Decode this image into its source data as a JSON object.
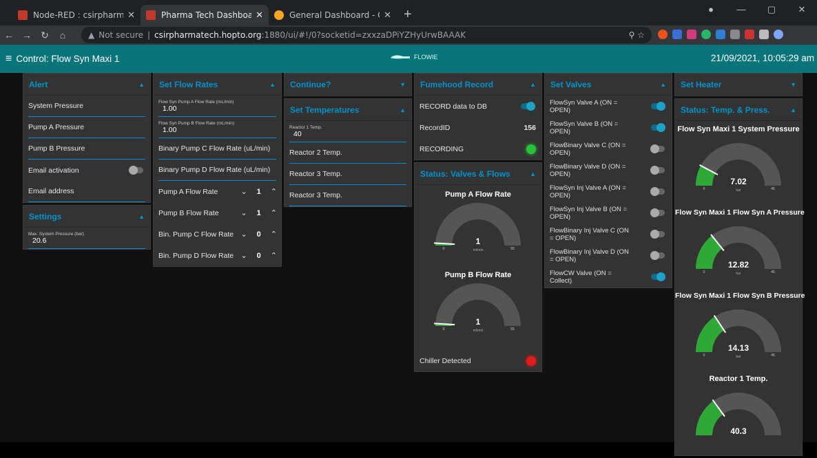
{
  "browser": {
    "tabs": [
      {
        "title": "Node-RED : csirpharmatech.hopt",
        "color": "#e53935"
      },
      {
        "title": "Pharma Tech Dashboard",
        "color": "#e53935"
      },
      {
        "title": "General Dashboard - Grafana",
        "color": "#f5a623"
      }
    ],
    "not_secure": "Not secure",
    "host": "csirpharmatech.hopto.org",
    "path": ":1880/ui/#!/0?socketid=zxxzaDPiYZHyUrwBAAAK"
  },
  "dashboard": {
    "title": "Control: Flow Syn Maxi 1",
    "logo": "FLOWIE",
    "clock": "21/09/2021, 10:05:29 am"
  },
  "alert": {
    "title": "Alert",
    "fields": [
      "System Pressure",
      "Pump A Pressure",
      "Pump B Pressure"
    ],
    "email_activation": "Email activation",
    "email_address": "Email address"
  },
  "settings": {
    "title": "Settings",
    "max_label": "Max. System Pressure (bar)",
    "max_value": "20.6"
  },
  "flow_rates": {
    "title": "Set Flow Rates",
    "pump_a_label": "Flow Syn Pump A Flow Rate (mL/min)",
    "pump_a_value": "1.00",
    "pump_b_label": "Flow Syn Pump B Flow Rate (mL/min)",
    "pump_b_value": "1.00",
    "bin_c": "Binary Pump C Flow Rate (uL/min)",
    "bin_d": "Binary Pump D Flow Rate (uL/min)",
    "steppers": [
      {
        "label": "Pump A Flow Rate",
        "value": "1"
      },
      {
        "label": "Pump B Flow Rate",
        "value": "1"
      },
      {
        "label": "Bin. Pump C Flow Rate",
        "value": "0"
      },
      {
        "label": "Bin. Pump D Flow Rate",
        "value": "0"
      }
    ]
  },
  "continue": {
    "title": "Continue?"
  },
  "temperatures": {
    "title": "Set Temperatures",
    "r1_label": "Reactor 1 Temp.",
    "r1_value": "40",
    "r2": "Reactor 2 Temp.",
    "r3a": "Reactor 3 Temp.",
    "r3b": "Reactor 3 Temp."
  },
  "fumehood": {
    "title": "Fumehood Record",
    "record": "RECORD data to DB",
    "record_id_label": "RecordID",
    "record_id": "156",
    "recording": "RECORDING"
  },
  "status_flows": {
    "title": "Status: Valves & Flows",
    "pump_a": {
      "title": "Pump A Flow Rate",
      "value": "1",
      "unit": "ml/min",
      "min": "0",
      "max": "55",
      "fraction": 0.018
    },
    "pump_b": {
      "title": "Pump B Flow Rate",
      "value": "1",
      "unit": "ml/min",
      "min": "0",
      "max": "55",
      "fraction": 0.018
    },
    "chiller": "Chiller Detected"
  },
  "valves": {
    "title": "Set Valves",
    "items": [
      {
        "label": "FlowSyn Valve A (ON = OPEN)",
        "on": true
      },
      {
        "label": "FlowSyn Valve B (ON = OPEN)",
        "on": true
      },
      {
        "label": "FlowBinary Valve C (ON = OPEN)",
        "on": false
      },
      {
        "label": "FlowBinary Valve D (ON = OPEN)",
        "on": false
      },
      {
        "label": "FlowSyn Inj Valve A (ON = OPEN)",
        "on": false
      },
      {
        "label": "FlowSyn Inj Valve B (ON = OPEN)",
        "on": false
      },
      {
        "label": "FlowBinary Inj Valve C (ON = OPEN)",
        "on": false
      },
      {
        "label": "FlowBinary Inj Valve D (ON = OPEN)",
        "on": false
      },
      {
        "label": "FlowCW Valve (ON = Collect)",
        "on": true
      }
    ]
  },
  "heater": {
    "title": "Set Heater"
  },
  "status_temp": {
    "title": "Status: Temp. & Press.",
    "gauges": [
      {
        "title": "Flow Syn Maxi 1 System Pressure",
        "value": "7.02",
        "unit": "bar",
        "min": "0",
        "max": "45",
        "fraction": 0.156
      },
      {
        "title": "Flow Syn Maxi 1 Flow Syn A Pressure",
        "value": "12.82",
        "unit": "bar",
        "min": "0",
        "max": "45",
        "fraction": 0.285
      },
      {
        "title": "Flow Syn Maxi 1 Flow Syn B Pressure",
        "value": "14.13",
        "unit": "bar",
        "min": "0",
        "max": "45",
        "fraction": 0.314
      },
      {
        "title": "Reactor 1 Temp.",
        "value": "40.3",
        "unit": "",
        "min": "",
        "max": "",
        "fraction": 0.3
      }
    ]
  },
  "colors": {
    "accent": "#0094ce",
    "header": "#097479",
    "gauge_fill": "#2ea836",
    "led_green": "#27c33a",
    "led_red": "#e51c1c"
  }
}
